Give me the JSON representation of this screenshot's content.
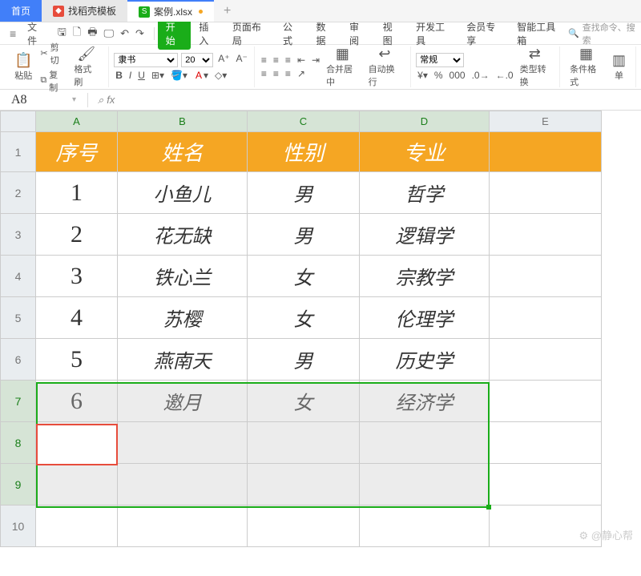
{
  "tabs": {
    "home": "首页",
    "doc1": "找稻壳模板",
    "doc2": "案例.xlsx"
  },
  "menu": {
    "file": "文件",
    "tabs": [
      "开始",
      "插入",
      "页面布局",
      "公式",
      "数据",
      "审阅",
      "视图",
      "开发工具",
      "会员专享",
      "智能工具箱"
    ],
    "active": 0,
    "search_placeholder": "查找命令、搜索"
  },
  "ribbon": {
    "paste": "粘贴",
    "cut": "剪切",
    "copy": "复制",
    "format_painter": "格式刷",
    "font_name": "隶书",
    "font_size": "20",
    "merge": "合并居中",
    "wrap": "自动换行",
    "numfmt": "常规",
    "type_convert": "类型转换",
    "cond_fmt": "条件格式",
    "cell": "单"
  },
  "namebox": "A8",
  "fx_label": "fx",
  "columns": [
    "A",
    "B",
    "C",
    "D",
    "E"
  ],
  "rows": [
    "1",
    "2",
    "3",
    "4",
    "5",
    "6",
    "7",
    "8",
    "9",
    "10"
  ],
  "header": {
    "A": "序号",
    "B": "姓名",
    "C": "性别",
    "D": "专业"
  },
  "data": [
    {
      "A": "1",
      "B": "小鱼儿",
      "C": "男",
      "D": "哲学"
    },
    {
      "A": "2",
      "B": "花无缺",
      "C": "男",
      "D": "逻辑学"
    },
    {
      "A": "3",
      "B": "铁心兰",
      "C": "女",
      "D": "宗教学"
    },
    {
      "A": "4",
      "B": "苏樱",
      "C": "女",
      "D": "伦理学"
    },
    {
      "A": "5",
      "B": "燕南天",
      "C": "男",
      "D": "历史学"
    },
    {
      "A": "6",
      "B": "邀月",
      "C": "女",
      "D": "经济学"
    }
  ],
  "watermark": "⚙ @静心帮",
  "chart_data": {
    "type": "table",
    "columns": [
      "序号",
      "姓名",
      "性别",
      "专业"
    ],
    "rows": [
      [
        1,
        "小鱼儿",
        "男",
        "哲学"
      ],
      [
        2,
        "花无缺",
        "男",
        "逻辑学"
      ],
      [
        3,
        "铁心兰",
        "女",
        "宗教学"
      ],
      [
        4,
        "苏樱",
        "女",
        "伦理学"
      ],
      [
        5,
        "燕南天",
        "男",
        "历史学"
      ],
      [
        6,
        "邀月",
        "女",
        "经济学"
      ]
    ]
  }
}
